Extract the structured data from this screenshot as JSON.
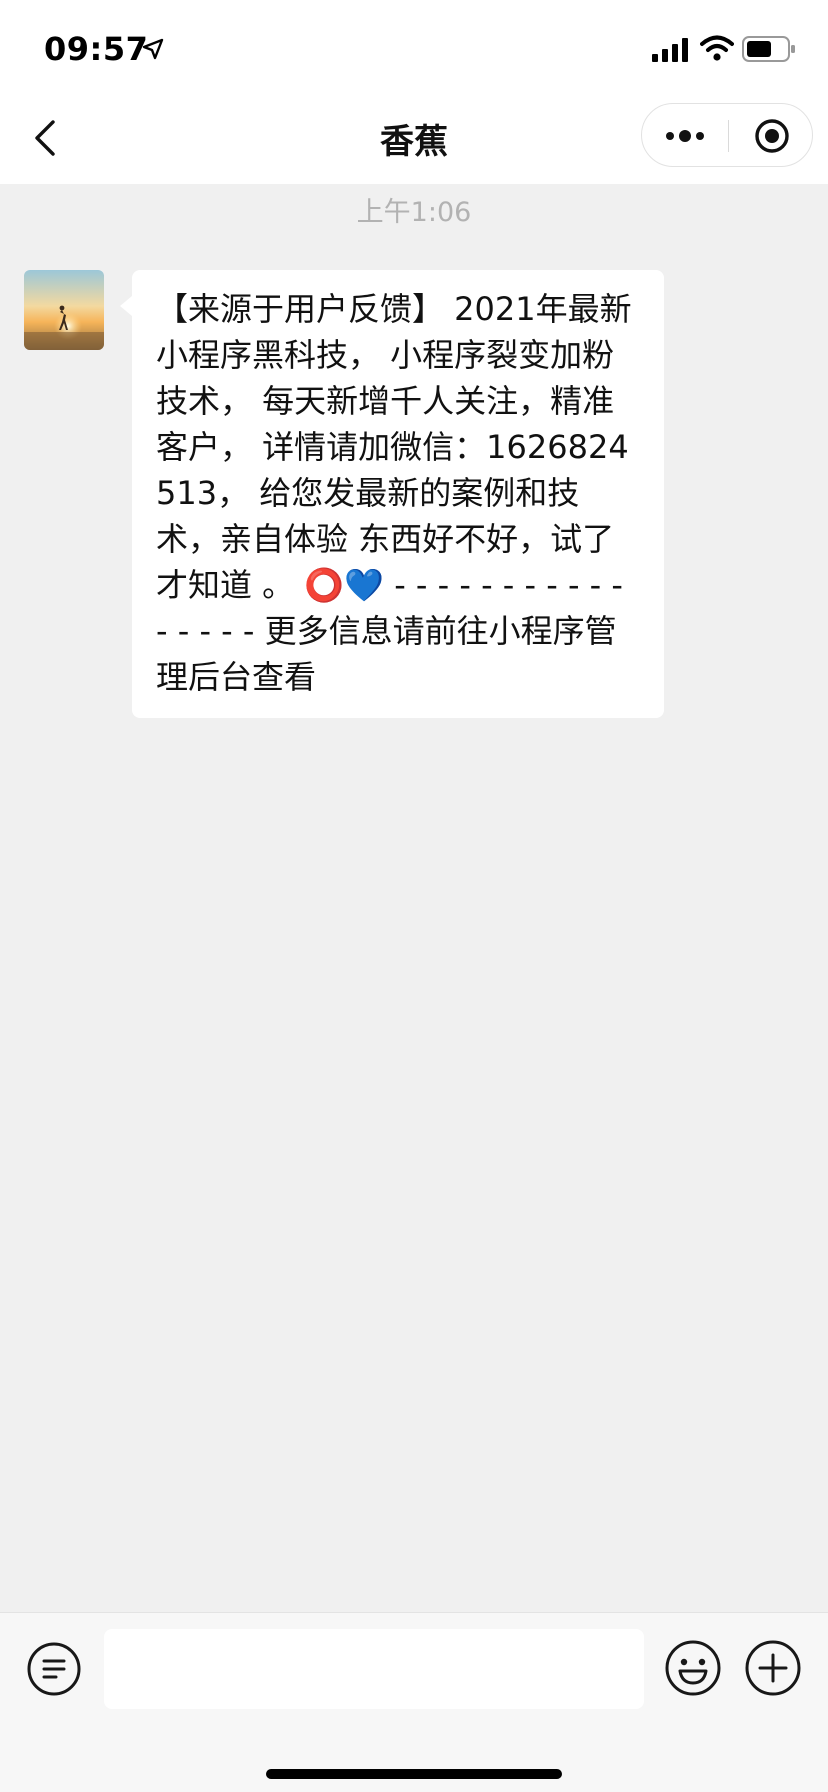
{
  "status_bar": {
    "time": "09:57",
    "icons": [
      "location-arrow-icon",
      "signal-icon",
      "wifi-icon",
      "battery-icon"
    ]
  },
  "nav": {
    "title": "香蕉",
    "icons": [
      "chevron-left-icon",
      "more-dots-icon",
      "record-circle-icon"
    ]
  },
  "chat": {
    "timestamp": "上午1:06",
    "message": "【来源于用户反馈】 2021年最新小程序黑科技， 小程序裂变加粉技术， 每天新增千人关注，精准客户， 详情请加微信：1626824513， 给您发最新的案例和技术，亲自体验 东西好不好，试了才知道 。 ⭕💙 - - - - - - - - - - - - - - - - 更多信息请前往小程序管理后台查看"
  },
  "input_bar": {
    "placeholder": "",
    "icons": [
      "voice-icon",
      "emoji-icon",
      "plus-icon"
    ]
  },
  "colors": {
    "background": "#F0F0F0",
    "bubble": "#FFFFFF",
    "timestamp": "#B2B2B2"
  }
}
